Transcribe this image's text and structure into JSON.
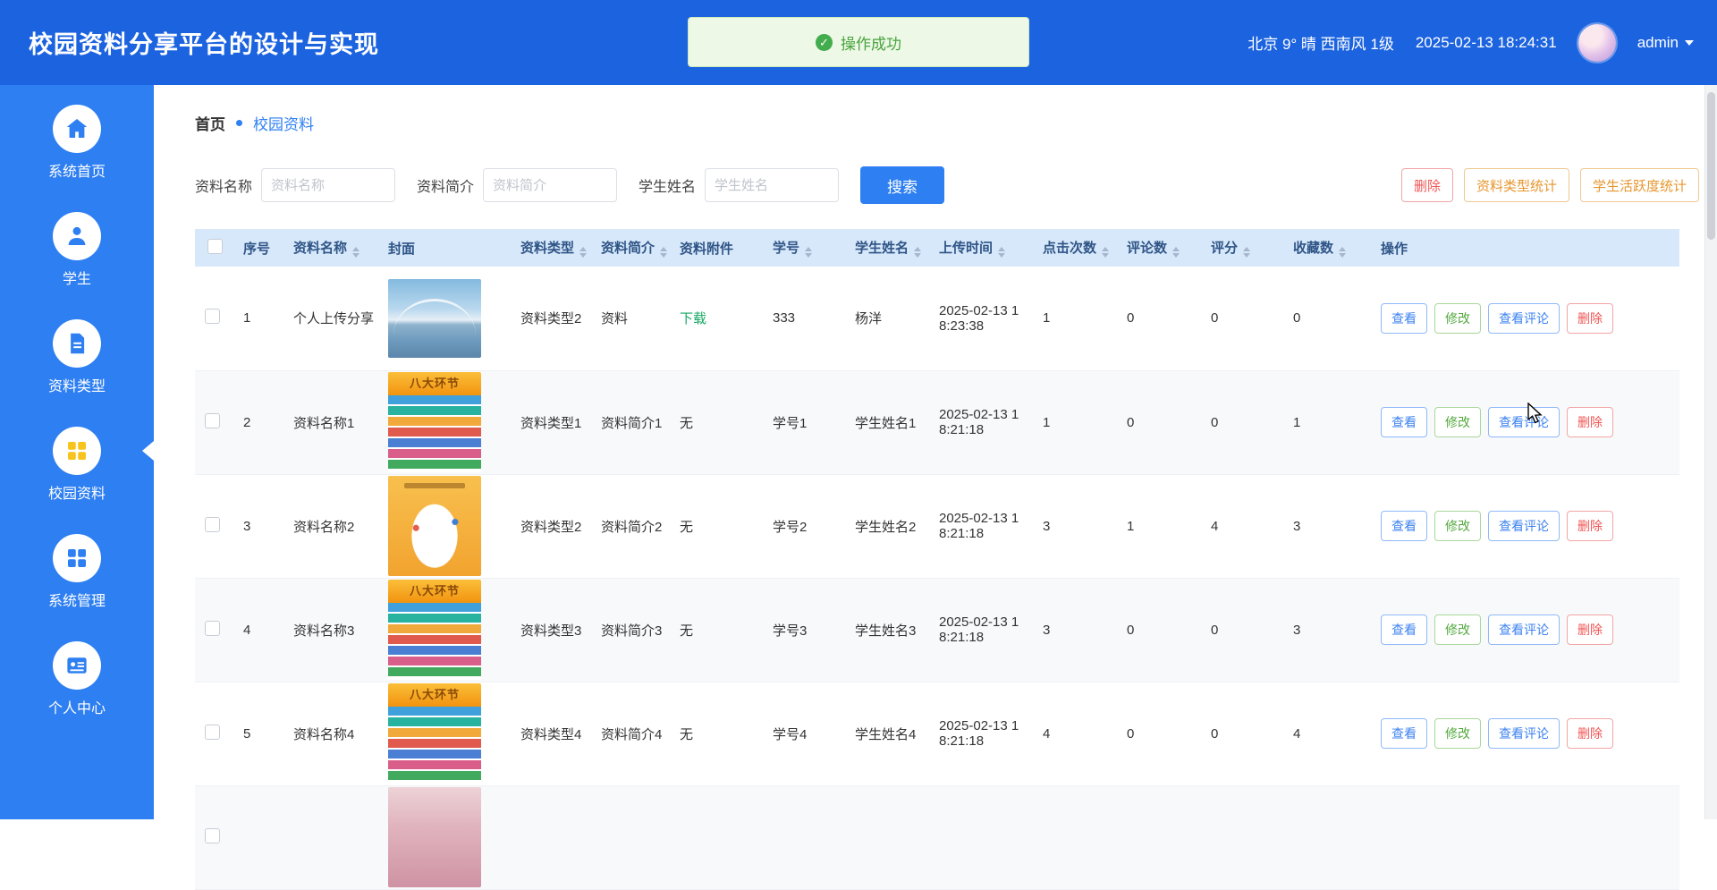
{
  "colors": {
    "header_bg": "#1c63e0",
    "sidebar_bg": "#2e7ff2",
    "accent": "#2e7ff2",
    "active_icon": "#f6c41c",
    "success": "#43ad4e",
    "success_bg": "#edf8e6",
    "danger": "#f05555",
    "warning": "#e6962e",
    "table_header_bg": "#d6e8fa",
    "download_link": "#17a763"
  },
  "header": {
    "title": "校园资料分享平台的设计与实现",
    "toast": "操作成功",
    "weather": "北京 9° 晴 西南风 1级",
    "datetime": "2025-02-13 18:24:31",
    "username": "admin"
  },
  "sidebar": {
    "items": [
      {
        "label": "系统首页",
        "icon": "home-icon",
        "active": false
      },
      {
        "label": "学生",
        "icon": "student-icon",
        "active": false
      },
      {
        "label": "资料类型",
        "icon": "document-icon",
        "active": false
      },
      {
        "label": "校园资料",
        "icon": "grid-icon",
        "active": true
      },
      {
        "label": "系统管理",
        "icon": "grid-icon",
        "active": false
      },
      {
        "label": "个人中心",
        "icon": "profile-card-icon",
        "active": false
      }
    ]
  },
  "breadcrumb": {
    "home": "首页",
    "current": "校园资料"
  },
  "filters": {
    "name_label": "资料名称",
    "name_placeholder": "资料名称",
    "intro_label": "资料简介",
    "intro_placeholder": "资料简介",
    "student_label": "学生姓名",
    "student_placeholder": "学生姓名",
    "search": "搜索",
    "delete": "删除",
    "type_stats": "资料类型统计",
    "activity_stats": "学生活跃度统计"
  },
  "table": {
    "columns": [
      {
        "label": "",
        "sortable": false
      },
      {
        "label": "序号",
        "sortable": false
      },
      {
        "label": "资料名称",
        "sortable": true
      },
      {
        "label": "封面",
        "sortable": false
      },
      {
        "label": "资料类型",
        "sortable": true
      },
      {
        "label": "资料简介",
        "sortable": true
      },
      {
        "label": "资料附件",
        "sortable": false
      },
      {
        "label": "学号",
        "sortable": true
      },
      {
        "label": "学生姓名",
        "sortable": true
      },
      {
        "label": "上传时间",
        "sortable": true
      },
      {
        "label": "点击次数",
        "sortable": true
      },
      {
        "label": "评论数",
        "sortable": true
      },
      {
        "label": "评分",
        "sortable": true
      },
      {
        "label": "收藏数",
        "sortable": true
      },
      {
        "label": "操作",
        "sortable": false
      }
    ],
    "row_actions": [
      {
        "label": "查看",
        "style": "primary"
      },
      {
        "label": "修改",
        "style": "success"
      },
      {
        "label": "查看评论",
        "style": "primary"
      },
      {
        "label": "删除",
        "style": "danger"
      }
    ],
    "cover_titles": {
      "eight": "八大环节"
    },
    "rows": [
      {
        "no": "1",
        "name": "个人上传分享",
        "cover": "bridge",
        "type": "资料类型2",
        "intro": "资料",
        "attachment": "下载",
        "attachment_is_link": true,
        "student_no": "333",
        "student_name": "杨洋",
        "upload_time": "2025-02-13 18:23:38",
        "clicks": "1",
        "comments": "0",
        "rating": "0",
        "favorites": "0",
        "partial": false
      },
      {
        "no": "2",
        "name": "资料名称1",
        "cover": "eight",
        "type": "资料类型1",
        "intro": "资料简介1",
        "attachment": "无",
        "attachment_is_link": false,
        "student_no": "学号1",
        "student_name": "学生姓名1",
        "upload_time": "2025-02-13 18:21:18",
        "clicks": "1",
        "comments": "0",
        "rating": "0",
        "favorites": "1",
        "partial": false
      },
      {
        "no": "3",
        "name": "资料名称2",
        "cover": "baby",
        "type": "资料类型2",
        "intro": "资料简介2",
        "attachment": "无",
        "attachment_is_link": false,
        "student_no": "学号2",
        "student_name": "学生姓名2",
        "upload_time": "2025-02-13 18:21:18",
        "clicks": "3",
        "comments": "1",
        "rating": "4",
        "favorites": "3",
        "partial": false
      },
      {
        "no": "4",
        "name": "资料名称3",
        "cover": "eight",
        "type": "资料类型3",
        "intro": "资料简介3",
        "attachment": "无",
        "attachment_is_link": false,
        "student_no": "学号3",
        "student_name": "学生姓名3",
        "upload_time": "2025-02-13 18:21:18",
        "clicks": "3",
        "comments": "0",
        "rating": "0",
        "favorites": "3",
        "partial": false
      },
      {
        "no": "5",
        "name": "资料名称4",
        "cover": "eight",
        "type": "资料类型4",
        "intro": "资料简介4",
        "attachment": "无",
        "attachment_is_link": false,
        "student_no": "学号4",
        "student_name": "学生姓名4",
        "upload_time": "2025-02-13 18:21:18",
        "clicks": "4",
        "comments": "0",
        "rating": "0",
        "favorites": "4",
        "partial": false
      },
      {
        "no": "",
        "name": "",
        "cover": "pink",
        "type": "",
        "intro": "",
        "attachment": "",
        "attachment_is_link": false,
        "student_no": "",
        "student_name": "",
        "upload_time": "",
        "clicks": "",
        "comments": "",
        "rating": "",
        "favorites": "",
        "partial": true
      }
    ]
  }
}
